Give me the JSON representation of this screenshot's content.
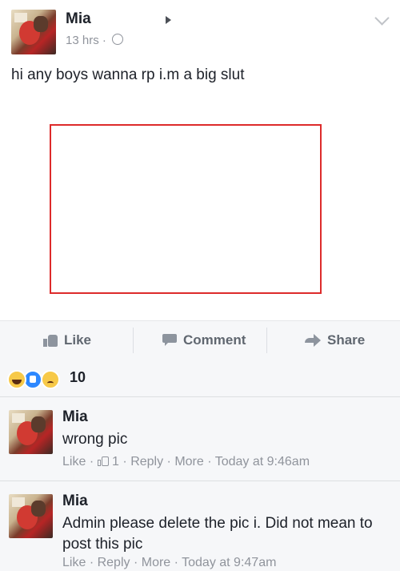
{
  "post": {
    "author": "Mia",
    "time": "13 hrs",
    "separator": "·",
    "text": "hi any boys wanna rp i.m a big slut"
  },
  "actions": {
    "like": "Like",
    "comment": "Comment",
    "share": "Share"
  },
  "reactions": {
    "icons": [
      "haha-icon",
      "like-icon",
      "sad-icon"
    ],
    "count": "10"
  },
  "comments": [
    {
      "author": "Mia",
      "text": "wrong pic",
      "like": "Like",
      "like_count": "1",
      "reply": "Reply",
      "more": "More",
      "time": "Today at 9:46am"
    },
    {
      "author": "Mia",
      "text": "Admin please delete the pic i. Did not mean to post this pic",
      "like": "Like",
      "reply": "Reply",
      "more": "More",
      "time": "Today at 9:47am"
    }
  ],
  "colors": {
    "annotation_box": "#dd2b2b",
    "meta_text": "#90949c",
    "action_text": "#606770"
  }
}
